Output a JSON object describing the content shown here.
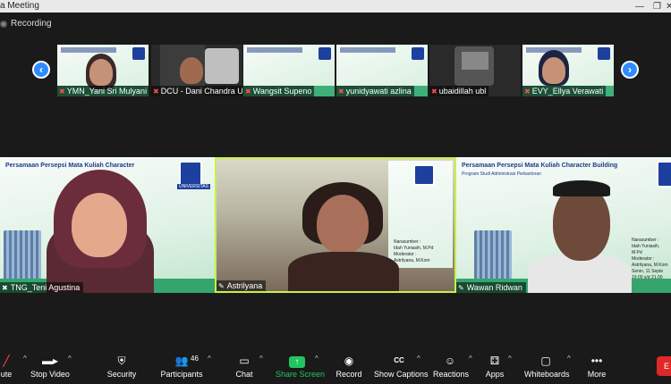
{
  "window": {
    "title": "a Meeting",
    "minimize_glyph": "—",
    "restore_glyph": "❐",
    "close_glyph": "✕"
  },
  "recording": {
    "label": "Recording"
  },
  "strip": {
    "prev_glyph": "‹",
    "next_glyph": "›",
    "thumbs": [
      {
        "name": "YMN_Yani Sri Mulyani"
      },
      {
        "name": "DCU - Dani Chandra U..."
      },
      {
        "name": "Wangsit Supeno"
      },
      {
        "name": "yunidyawati azlina"
      },
      {
        "name": "ubaidillah ubl"
      },
      {
        "name": "EVY_Ellya Verawati"
      }
    ]
  },
  "tiles": {
    "left": {
      "slide_title": "Persamaan Persepsi Mata Kuliah Character",
      "name": "TNG_Teni Agustina"
    },
    "center": {
      "narasumber_label": "Narasumber :",
      "narasumber": "Idah Yuniasih, M.Pd",
      "moderator_label": "Moderator :",
      "moderator": "Astrilyana, M.Kom",
      "name": "Astrilyana"
    },
    "right": {
      "slide_title": "Persamaan Persepsi Mata Kuliah Character Building",
      "slide_sub": "Program Studi Administrasi Perkantoran",
      "narasumber_label": "Narasumber :",
      "narasumber": "Idah Yuniasih, M.Pd",
      "moderator_label": "Moderator :",
      "moderator": "Astrilyana, M.Kom",
      "date": "Senin, 11 Septe",
      "time": "19.00 s/d 21.00",
      "name": "Wawan Ridwan"
    },
    "logo_text": "UNIVERSITAS"
  },
  "toolbar": {
    "mute": "ute",
    "stop_video": "Stop Video",
    "security": "Security",
    "participants": "Participants",
    "participants_count": "46",
    "chat": "Chat",
    "share_screen": "Share Screen",
    "record": "Record",
    "show_captions": "Show Captions",
    "reactions": "Reactions",
    "apps": "Apps",
    "whiteboards": "Whiteboards",
    "more": "More",
    "end": "E",
    "cc_glyph": "CC",
    "caret": "^"
  },
  "colors": {
    "accent": "#2d8cff",
    "active_speaker": "#c8f04a",
    "share": "#23c55e",
    "end": "#e02828"
  }
}
